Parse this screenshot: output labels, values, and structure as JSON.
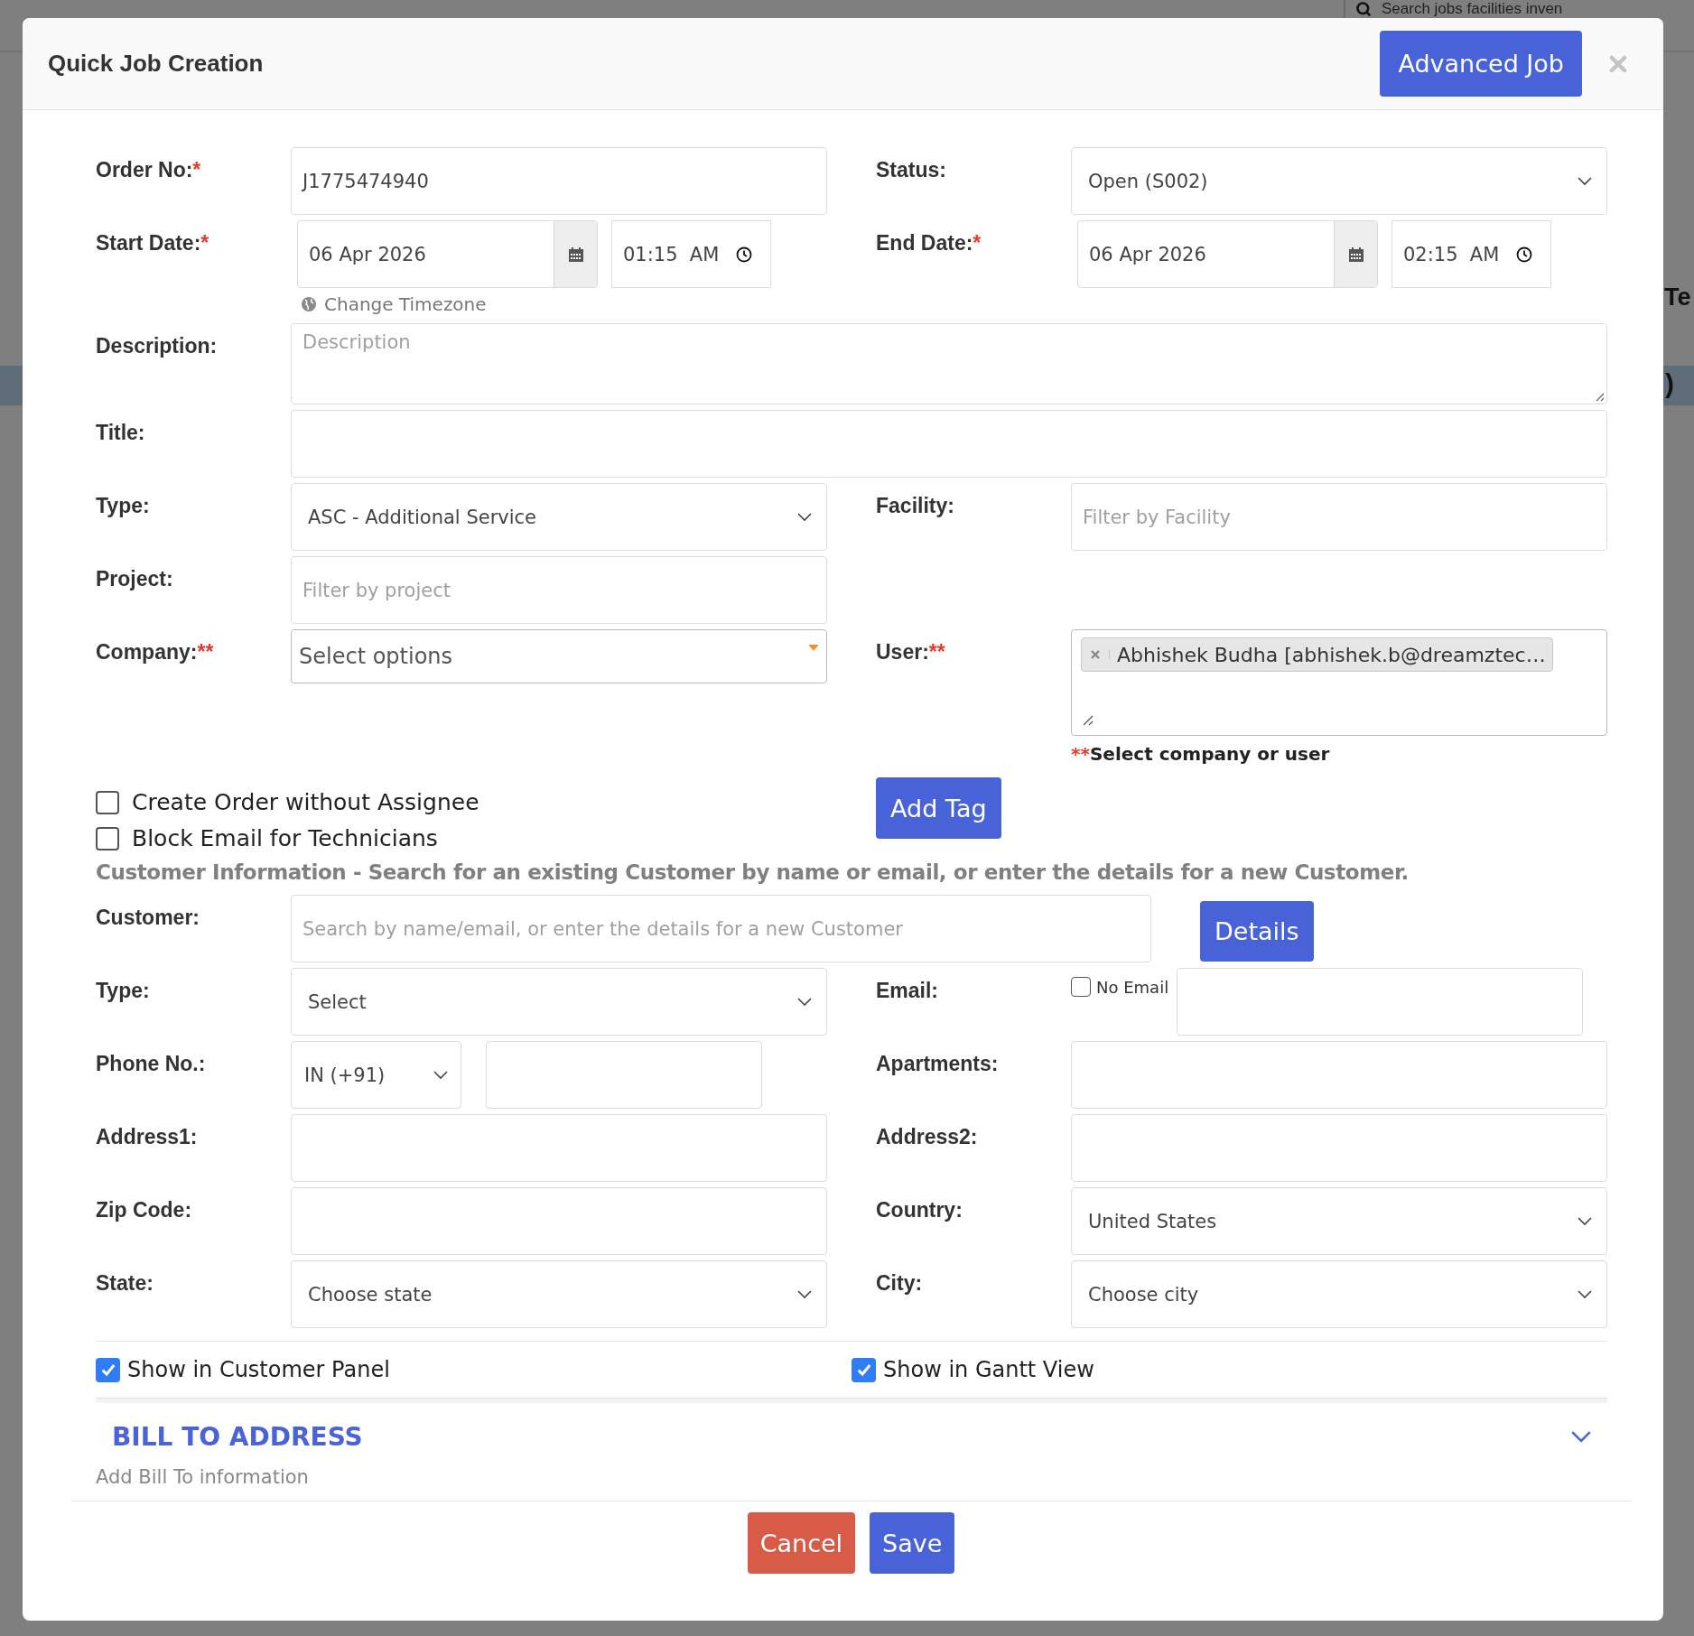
{
  "background": {
    "search_placeholder": "Search  jobs  facilities  inven",
    "fragments": [
      "Te",
      ")"
    ]
  },
  "dialog": {
    "title": "Quick Job Creation",
    "advanced_button": "Advanced Job"
  },
  "rows": [
    {
      "left": {
        "label": "Order No:",
        "required": "*",
        "kind": "text",
        "value": "J1775474940"
      },
      "right": {
        "label": "Status:",
        "kind": "select",
        "value": "Open (S002)"
      }
    },
    {
      "left": {
        "label": "Start Date:",
        "required": "*",
        "kind": "datetime",
        "date": "06 Apr 2026",
        "time": "01:15  AM"
      },
      "right": {
        "label": "End Date:",
        "required": "*",
        "kind": "datetime",
        "date": "06 Apr 2026",
        "time": "02:15  AM"
      },
      "note": "Change Timezone"
    },
    {
      "full": {
        "label": "Description:",
        "kind": "textarea",
        "placeholder": "Description"
      }
    },
    {
      "full": {
        "label": "Title:",
        "kind": "text"
      }
    },
    {
      "left": {
        "label": "Type:",
        "kind": "select",
        "value": "ASC - Additional Service"
      },
      "right": {
        "label": "Facility:",
        "kind": "text",
        "placeholder": "Filter by Facility"
      }
    },
    {
      "left": {
        "label": "Project:",
        "kind": "text",
        "placeholder": "Filter by project"
      }
    },
    {
      "left": {
        "label": "Company:",
        "required": "**",
        "kind": "multiselect",
        "placeholder": "Select options"
      },
      "right": {
        "label": "User:",
        "required": "**",
        "kind": "chips",
        "chips": [
          "Abhishek Budha [abhishek.b@dreamztec…"
        ],
        "hint_mark": "**",
        "hint": "Select company or user"
      }
    }
  ],
  "checks": [
    {
      "label": "Create Order without Assignee",
      "checked": false
    },
    {
      "label": "Block Email for Technicians",
      "checked": false
    }
  ],
  "add_tag_button": "Add Tag",
  "customer_heading": "Customer Information - Search for an existing Customer by name or email, or enter the details for a new Customer.",
  "customer_rows": [
    {
      "full": {
        "label": "Customer:",
        "kind": "text",
        "placeholder": "Search by name/email, or enter the details for a new Customer"
      },
      "button": "Details"
    },
    {
      "left": {
        "label": "Type:",
        "kind": "select",
        "value": "Select"
      },
      "right": {
        "label": "Email:",
        "kind": "email",
        "option": "No Email",
        "checked": false
      }
    },
    {
      "left": {
        "label": "Phone No.:",
        "kind": "phone",
        "value": "IN (+91)"
      },
      "right": {
        "label": "Apartments:",
        "kind": "text"
      }
    },
    {
      "left": {
        "label": "Address1:",
        "kind": "text"
      },
      "right": {
        "label": "Address2:",
        "kind": "text"
      }
    },
    {
      "left": {
        "label": "Zip Code:",
        "kind": "text"
      },
      "right": {
        "label": "Country:",
        "kind": "select",
        "value": "United States"
      }
    },
    {
      "left": {
        "label": "State:",
        "kind": "select",
        "value": "Choose state"
      },
      "right": {
        "label": "City:",
        "kind": "select",
        "value": "Choose city"
      }
    }
  ],
  "show_options": [
    {
      "label": "Show in Customer Panel",
      "checked": true
    },
    {
      "label": "Show in Gantt View",
      "checked": true
    }
  ],
  "bill_to": {
    "title": "BILL TO ADDRESS",
    "subtitle": "Add Bill To information"
  },
  "footer_buttons": [
    {
      "label": "Cancel",
      "kind": "danger"
    },
    {
      "label": "Save",
      "kind": "primary"
    }
  ]
}
